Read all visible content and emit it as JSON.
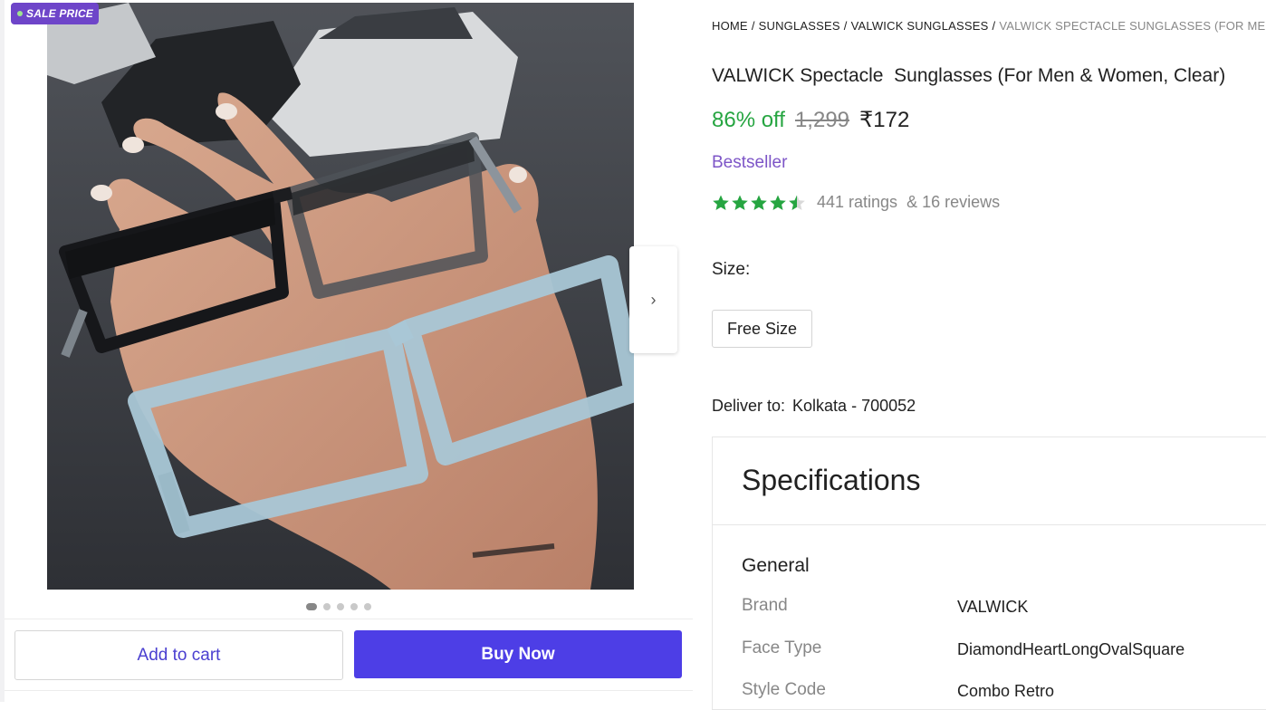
{
  "gallery": {
    "sale_badge": "SALE PRICE",
    "image_alt": "Two eyeglass frames held in a hand",
    "slide_count": 5,
    "active_slide": 0
  },
  "actions": {
    "add_to_cart": "Add to cart",
    "buy_now": "Buy Now"
  },
  "breadcrumb": [
    {
      "label": "HOME"
    },
    {
      "label": "SUNGLASSES"
    },
    {
      "label": "VALWICK SUNGLASSES"
    },
    {
      "label": "VALWICK SPECTACLE SUNGLASSES (FOR MEN & WOMEN, CLEAR)"
    }
  ],
  "product": {
    "title": "VALWICK Spectacle  Sunglasses (For Men & Women, Clear)",
    "discount": "86% off",
    "mrp": "1,299",
    "price": "₹172",
    "badge": "Bestseller",
    "rating_stars": 4.5,
    "ratings": "441 ratings",
    "reviews": "& 16 reviews"
  },
  "size": {
    "label": "Size:",
    "options": [
      "Free Size"
    ]
  },
  "delivery": {
    "label": "Deliver to:",
    "location": "Kolkata - 700052"
  },
  "specifications": {
    "title": "Specifications",
    "section": "General",
    "rows": [
      {
        "key": "Brand",
        "value": "VALWICK"
      },
      {
        "key": "Face Type",
        "value": "DiamondHeartLongOvalSquare"
      },
      {
        "key": "Style Code",
        "value": "Combo Retro"
      }
    ]
  },
  "colors": {
    "accent": "#4d3ee6",
    "discount": "#26a541",
    "badge_purple": "#7d55c7",
    "star_green": "#26a541"
  },
  "icons": {
    "next": "chevron-right-icon",
    "star": "star-icon"
  }
}
